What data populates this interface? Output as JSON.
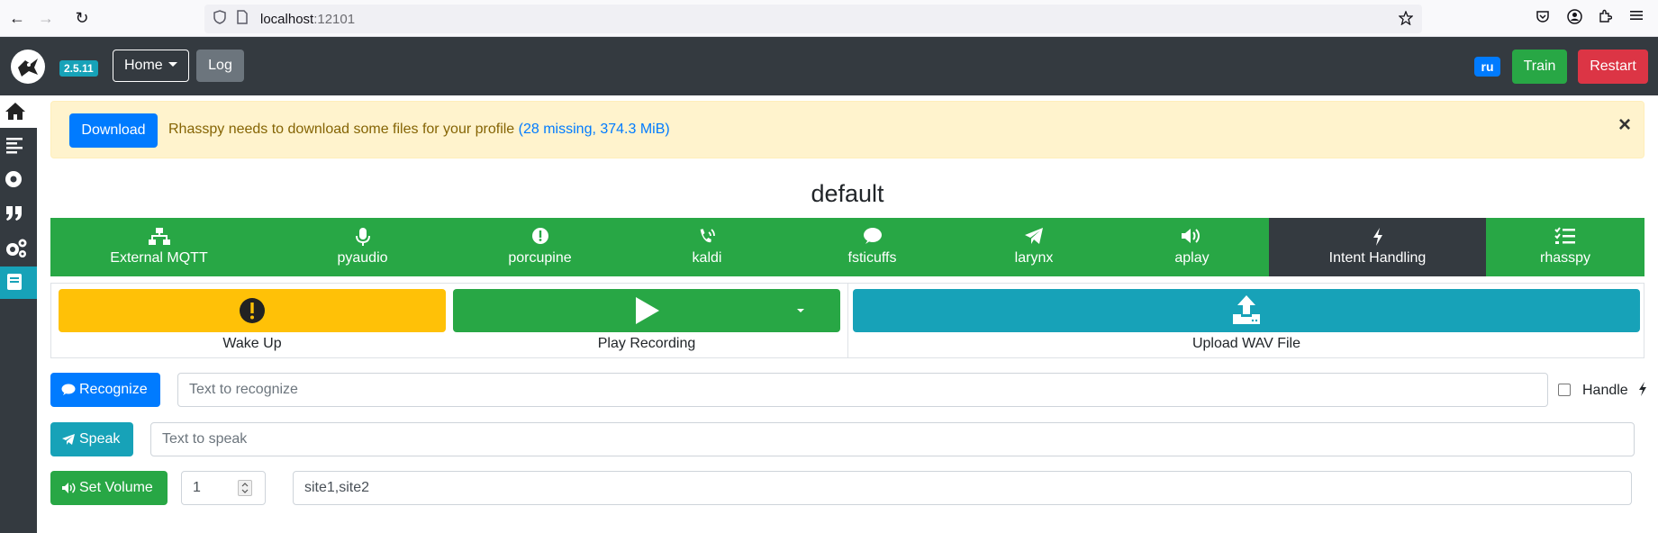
{
  "browser": {
    "url_host": "localhost",
    "url_port": ":12101"
  },
  "navbar": {
    "version": "2.5.11",
    "home_label": "Home",
    "log_label": "Log",
    "language_badge": "ru",
    "train_label": "Train",
    "restart_label": "Restart"
  },
  "alert": {
    "download_label": "Download",
    "message": "Rhasspy needs to download some files for your profile",
    "missing_info": "(28 missing, 374.3 MiB)",
    "close_symbol": "×"
  },
  "profile": {
    "name": "default"
  },
  "services": [
    {
      "label": "External MQTT",
      "icon": "network-icon"
    },
    {
      "label": "pyaudio",
      "icon": "microphone-icon"
    },
    {
      "label": "porcupine",
      "icon": "exclamation-circle-icon"
    },
    {
      "label": "kaldi",
      "icon": "phone-volume-icon"
    },
    {
      "label": "fsticuffs",
      "icon": "comment-icon"
    },
    {
      "label": "larynx",
      "icon": "paper-plane-icon"
    },
    {
      "label": "aplay",
      "icon": "volume-up-icon"
    },
    {
      "label": "Intent Handling",
      "icon": "bolt-icon"
    },
    {
      "label": "rhasspy",
      "icon": "tasks-icon"
    }
  ],
  "actions": {
    "wake_label": "Wake Up",
    "play_label": "Play Recording",
    "upload_label": "Upload WAV File"
  },
  "recognize": {
    "button_label": "Recognize",
    "placeholder": "Text to recognize",
    "handle_label": "Handle"
  },
  "speak": {
    "button_label": "Speak",
    "placeholder": "Text to speak"
  },
  "volume": {
    "button_label": "Set Volume",
    "value": "1",
    "sites": "site1,site2"
  },
  "colors": {
    "primary": "#007bff",
    "success": "#28a745",
    "danger": "#dc3545",
    "warning": "#ffc107",
    "info": "#17a2b8",
    "dark": "#343a40"
  }
}
